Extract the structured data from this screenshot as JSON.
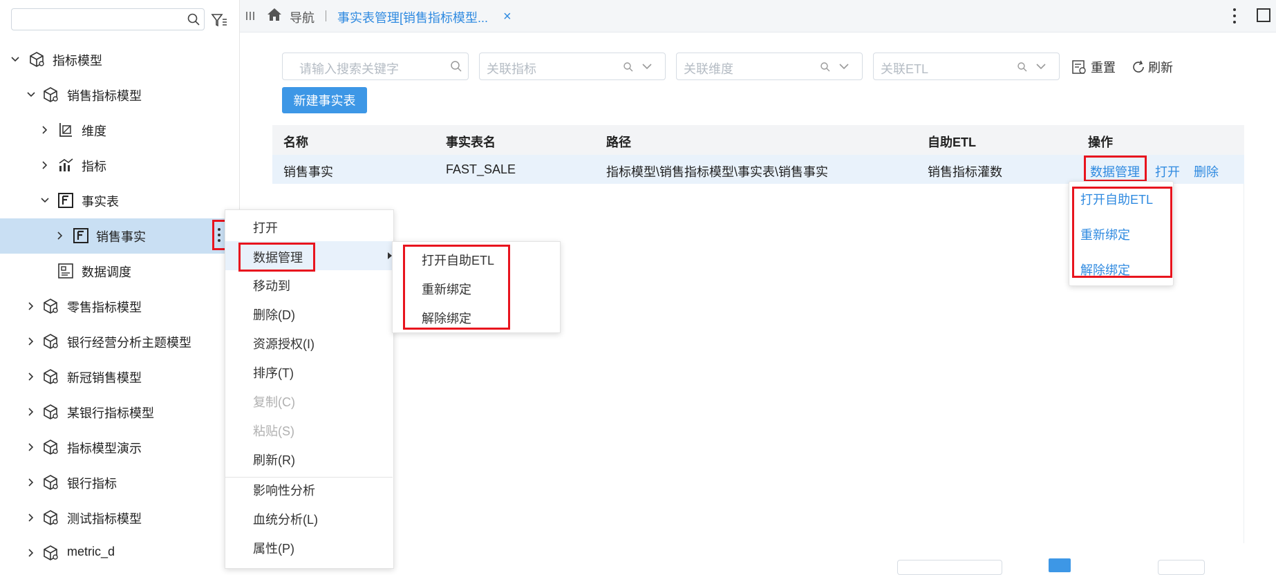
{
  "tree": {
    "search_placeholder": "",
    "items": [
      {
        "label": "指标模型",
        "icon": "cube-model-icon"
      },
      {
        "label": "销售指标模型",
        "icon": "cube-model-icon"
      },
      {
        "label": "维度",
        "icon": "dimension-icon"
      },
      {
        "label": "指标",
        "icon": "metric-chart-icon"
      },
      {
        "label": "事实表",
        "icon": "fact-table-icon"
      },
      {
        "label": "销售事实",
        "icon": "fact-table-icon"
      },
      {
        "label": "数据调度",
        "icon": "schedule-icon"
      },
      {
        "label": "零售指标模型",
        "icon": "cube-model-icon"
      },
      {
        "label": "银行经营分析主题模型",
        "icon": "cube-model-icon"
      },
      {
        "label": "新冠销售模型",
        "icon": "cube-model-icon"
      },
      {
        "label": "某银行指标模型",
        "icon": "cube-model-icon"
      },
      {
        "label": "指标模型演示",
        "icon": "cube-model-icon"
      },
      {
        "label": "银行指标",
        "icon": "cube-model-icon"
      },
      {
        "label": "测试指标模型",
        "icon": "cube-model-icon"
      },
      {
        "label": "metric_d",
        "icon": "cube-model-icon"
      }
    ]
  },
  "topbar": {
    "nav_label": "导航",
    "tab_label": "事实表管理[销售指标模型...",
    "close_glyph": "×"
  },
  "filters": {
    "search_placeholder": "请输入搜索关键字",
    "metric_placeholder": "关联指标",
    "dimension_placeholder": "关联维度",
    "etl_placeholder": "关联ETL",
    "reset_label": "重置",
    "refresh_label": "刷新",
    "new_button": "新建事实表"
  },
  "table": {
    "headers": [
      "名称",
      "事实表名",
      "路径",
      "自助ETL",
      "操作"
    ],
    "rows": [
      {
        "name": "销售事实",
        "table_name": "FAST_SALE",
        "path": "指标模型\\销售指标模型\\事实表\\销售事实",
        "etl": "销售指标灌数",
        "actions": [
          "数据管理",
          "打开",
          "删除"
        ]
      }
    ]
  },
  "dropdown": {
    "items": [
      "打开自助ETL",
      "重新绑定",
      "解除绑定"
    ]
  },
  "context_menu": {
    "items": [
      {
        "label": "打开",
        "disabled": false
      },
      {
        "label": "数据管理",
        "disabled": false
      },
      {
        "label": "移动到",
        "disabled": false
      },
      {
        "label": "删除(D)",
        "disabled": false
      },
      {
        "label": "资源授权(I)",
        "disabled": false
      },
      {
        "label": "排序(T)",
        "disabled": false
      },
      {
        "label": "复制(C)",
        "disabled": true
      },
      {
        "label": "粘贴(S)",
        "disabled": true
      },
      {
        "label": "刷新(R)",
        "disabled": false
      },
      {
        "label": "影响性分析",
        "disabled": false
      },
      {
        "label": "血统分析(L)",
        "disabled": false
      },
      {
        "label": "属性(P)",
        "disabled": false
      }
    ]
  },
  "submenu": {
    "items": [
      "打开自助ETL",
      "重新绑定",
      "解除绑定"
    ]
  },
  "colors": {
    "accent": "#3d97e6",
    "link": "#2f8ae0",
    "highlight_border": "#e8141e",
    "selected_row": "#c9dff3"
  }
}
